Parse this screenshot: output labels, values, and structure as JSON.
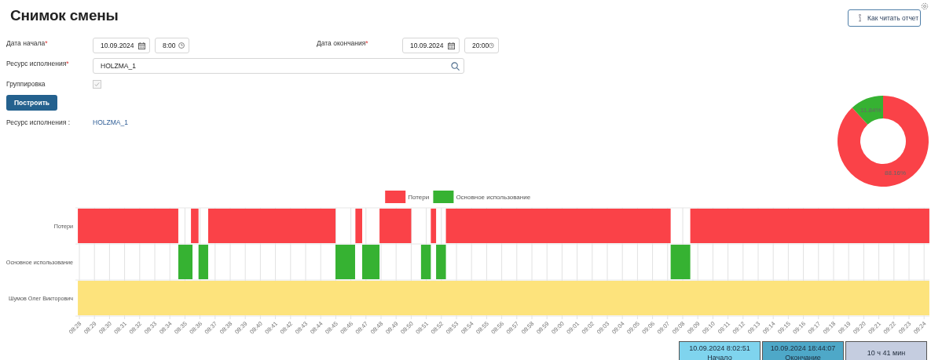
{
  "title": "Снимок смены",
  "help_button": {
    "label": "Как читать отчет"
  },
  "form": {
    "start": {
      "label": "Дата начала",
      "required_mark": "*",
      "date": "10.09.2024",
      "time": "8:00"
    },
    "end": {
      "label": "Дата окончания",
      "required_mark": "*",
      "date": "10.09.2024",
      "time": "20:00"
    },
    "resource": {
      "label": "Ресурс исполнения",
      "required_mark": "*",
      "value": "HOLZMA_1"
    },
    "grouping": {
      "label": "Группировка",
      "checked": true,
      "disabled": true
    }
  },
  "build_button": {
    "label": "Построить"
  },
  "result": {
    "label": "Ресурс исполнения :",
    "value": "HOLZMA_1"
  },
  "donut": {
    "chart_data": {
      "type": "donut",
      "values": [
        88.16,
        11.84
      ],
      "colors": [
        "#fa4248",
        "#36b232"
      ],
      "value_labels": [
        "88.16%",
        "11.84%"
      ]
    }
  },
  "timeline": {
    "legend": [
      {
        "label": "Потери",
        "color": "#fa4248"
      },
      {
        "label": "Основное использование",
        "color": "#36b232"
      }
    ],
    "rows": [
      {
        "label": "Потери",
        "color": "#fa4248"
      },
      {
        "label": "Основное использование",
        "color": "#36b232"
      },
      {
        "label": "Шумов Олег Викторович",
        "color": "#fde37c"
      }
    ],
    "time_labels": [
      "08:28",
      "08:29",
      "08:30",
      "08:31",
      "08:32",
      "08:33",
      "08:34",
      "08:35",
      "08:36",
      "08:37",
      "08:38",
      "08:39",
      "08:40",
      "08:41",
      "08:42",
      "08:43",
      "08:44",
      "08:45",
      "08:46",
      "08:47",
      "08:48",
      "08:49",
      "08:50",
      "08:51",
      "08:52",
      "08:53",
      "08:54",
      "08:55",
      "08:56",
      "08:57",
      "08:58",
      "08:59",
      "09:00",
      "09:01",
      "09:02",
      "09:03",
      "09:04",
      "09:05",
      "09:06",
      "09:07",
      "09:08",
      "09:09",
      "09:10",
      "09:11",
      "09:12",
      "09:13",
      "09:14",
      "09:15",
      "09:16",
      "09:17",
      "09:18",
      "09:19",
      "09:20",
      "09:21",
      "09:22",
      "09:23",
      "09:24"
    ]
  },
  "summary": [
    {
      "value": "10.09.2024 8:02:51",
      "caption": "Начало",
      "color": "#7fd4ee"
    },
    {
      "value": "10.09.2024 18:44:07",
      "caption": "Окончание",
      "color": "#4ea8c8"
    },
    {
      "value": "10 ч 41 мин",
      "color": "#c5cde0"
    }
  ]
}
